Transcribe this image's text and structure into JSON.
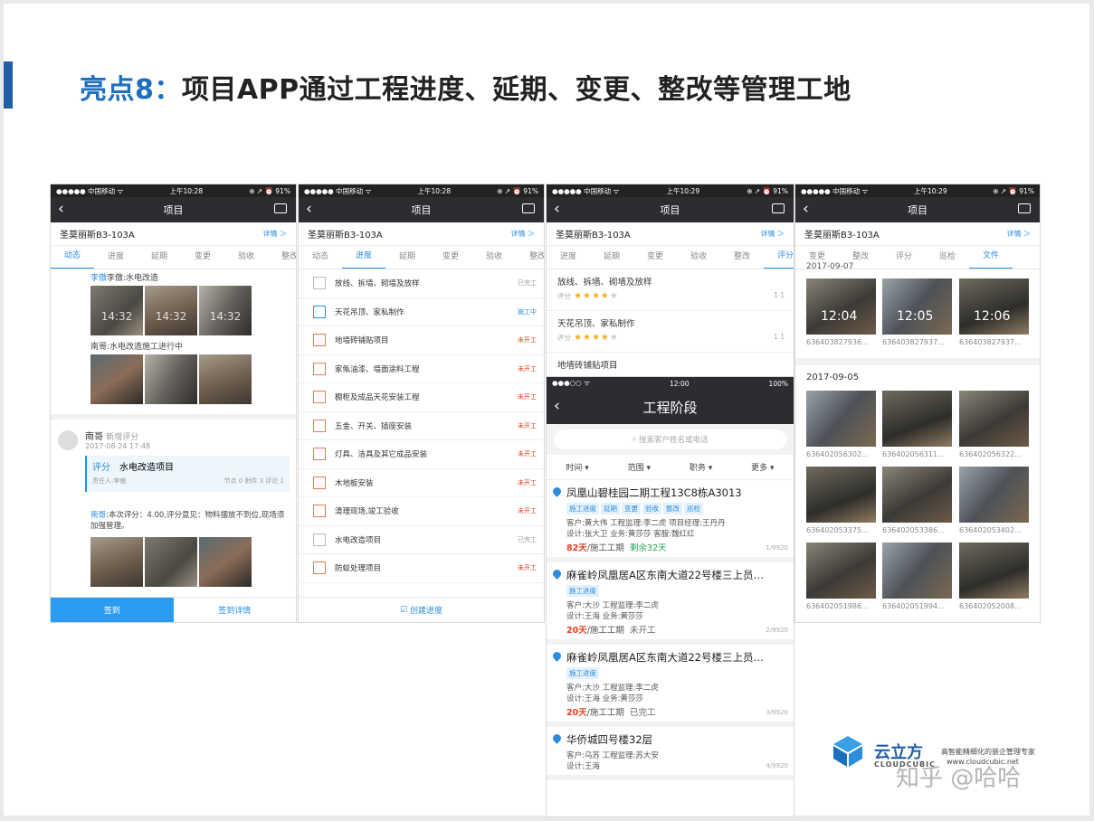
{
  "slide": {
    "title_hl": "亮点8：",
    "title": "项目APP通过工程进度、延期、变更、整改等管理工地"
  },
  "status": {
    "carrier": "●●●●● 中国移动 ᯤ",
    "battery": "⊕ ↗ ⏰ 91%",
    "time1": "上午10:28",
    "time2": "上午10:29"
  },
  "nav": {
    "title": "项目"
  },
  "project": {
    "name": "圣莫丽斯B3-103A",
    "detail": "详情 ＞"
  },
  "tabs1": [
    "动态",
    "进度",
    "延期",
    "变更",
    "验收",
    "整改"
  ],
  "tabs2": [
    "动态",
    "进度",
    "延期",
    "变更",
    "验收",
    "整改"
  ],
  "tabs3": [
    "进度",
    "延期",
    "变更",
    "验收",
    "整改",
    "评分"
  ],
  "tabs4": [
    "变更",
    "整改",
    "评分",
    "巡检",
    "文件"
  ],
  "feed": {
    "post1": "李傲:水电改造",
    "post2": "南哥:水电改造施工进行中",
    "stamps": [
      "14:32",
      "14:32",
      "14:32"
    ],
    "user": "南哥",
    "action": "新增评分",
    "date": "2017-08-24 17:48",
    "rating_label": "评分",
    "rating_item": "水电改造项目",
    "responsible": "责任人:李傲",
    "node_info": "节点 0   附件 3   评论 1",
    "comment_user": "南哥",
    "comment": ":本次评分：4.00,评分意见：物料摆放不到位,现场须加强管理。",
    "btn_signin": "签到",
    "btn_detail": "签到详情"
  },
  "progress": {
    "items": [
      {
        "label": "放线、拆墙、砌墙及放样",
        "status": "已完工",
        "kind": "done"
      },
      {
        "label": "天花吊顶、家私制作",
        "status": "施工中",
        "kind": "doing"
      },
      {
        "label": "地墙砖铺贴项目",
        "status": "未开工",
        "kind": "todo"
      },
      {
        "label": "家俬油漆、墙面涂料工程",
        "status": "未开工",
        "kind": "todo"
      },
      {
        "label": "橱柜及成品天花安装工程",
        "status": "未开工",
        "kind": "todo"
      },
      {
        "label": "五金、开关、插座安装",
        "status": "未开工",
        "kind": "todo"
      },
      {
        "label": "灯具、洁具及其它成品安装",
        "status": "未开工",
        "kind": "todo"
      },
      {
        "label": "木地板安装",
        "status": "未开工",
        "kind": "todo"
      },
      {
        "label": "清理现场,竣工验收",
        "status": "未开工",
        "kind": "todo"
      },
      {
        "label": "水电改造项目",
        "status": "已完工",
        "kind": "done"
      },
      {
        "label": "防蚁处理项目",
        "status": "未开工",
        "kind": "todo"
      }
    ],
    "create": "创建进度"
  },
  "score": {
    "items": [
      {
        "label": "放线、拆墙、砌墙及放样",
        "rate_label": "评分",
        "stars": 4,
        "counts": "1   1"
      },
      {
        "label": "天花吊顶、家私制作",
        "rate_label": "评分",
        "stars": 4,
        "counts": "1   1"
      },
      {
        "label": "地墙砖铺贴项目"
      }
    ]
  },
  "stage": {
    "status_left": "●●●○○ ᯤ",
    "status_time": "12:00",
    "status_right": "100%",
    "title": "工程阶段",
    "search": "搜索客户姓名或电话",
    "filters": [
      "时间 ▾",
      "范围 ▾",
      "职务 ▾",
      "更多 ▾"
    ],
    "cards": [
      {
        "title": "凤凰山碧桂园二期工程13C8栋A3013",
        "tags": [
          "施工进度",
          "延期",
          "变更",
          "验收",
          "整改",
          "巡检"
        ],
        "line1": "客户:黄大伟   工程监理:李二虎   项目经理:王丹丹",
        "line2": "设计:张大卫   业务:黄莎莎   客服:魏红红",
        "days": "82天",
        "period": "/施工工期",
        "state": "剩余32天",
        "page": "1/9920"
      },
      {
        "title": "麻雀岭凤凰居A区东南大道22号楼三上员…",
        "tags": [
          "施工进度"
        ],
        "line1": "客户:大沙   工程监理:李二虎",
        "line2": "设计:王海   业务:黄莎莎",
        "days": "20天",
        "period": "/施工工期",
        "state": "未开工",
        "page": "2/9920"
      },
      {
        "title": "麻雀岭凤凰居A区东南大道22号楼三上员…",
        "tags": [
          "施工进度"
        ],
        "line1": "客户:大沙   工程监理:李二虎",
        "line2": "设计:王海   业务:黄莎莎",
        "days": "20天",
        "period": "/施工工期",
        "state": "已完工",
        "page": "3/9920"
      },
      {
        "title": "华侨城四号楼32层",
        "tags": [],
        "line1": "客户:乌苏   工程监理:苏大安",
        "line2": "设计:王海",
        "days": "",
        "period": "",
        "state": "",
        "page": "4/9920"
      }
    ]
  },
  "files": {
    "date0": "2017-09-07",
    "date1": "2017-09-05",
    "stamps": [
      "12:04",
      "12:05",
      "12:06"
    ],
    "names": [
      "636403827936...",
      "636403827937...",
      "636403827937...",
      "636402056302...",
      "636402056311...",
      "636402056322...",
      "636402053375...",
      "636402053386...",
      "636402053402...",
      "636402051986...",
      "636402051994...",
      "636402052008..."
    ]
  },
  "brand": {
    "name": "云立方",
    "sub": "CLOUDCUBIC",
    "slogan": "高智能精细化的装企管理专家",
    "url": "www.cloudcubic.net",
    "watermark": "知乎 @哈哈"
  }
}
